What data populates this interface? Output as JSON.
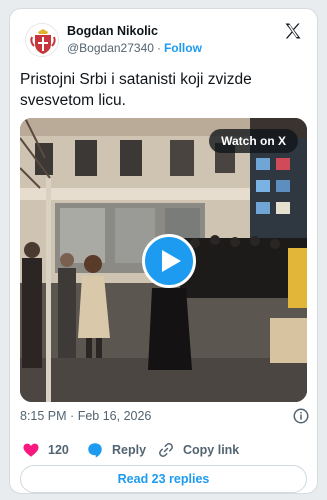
{
  "author": {
    "name": "Bogdan Nikolic",
    "handle": "@Bogdan27340",
    "separator": "·",
    "follow_label": "Follow",
    "avatar_icon": "serbian-coat-of-arms"
  },
  "platform_icon": "x-logo-icon",
  "tweet": {
    "text": "Pristojni Srbi i satanisti koji zvizde svesvetom licu."
  },
  "media": {
    "watch_label": "Watch on X",
    "play_icon": "play-icon"
  },
  "meta": {
    "time": "8:15 PM",
    "separator": "·",
    "date": "Feb 16, 2026",
    "info_icon": "info-icon"
  },
  "actions": {
    "likes": "120",
    "reply_label": "Reply",
    "copy_label": "Copy link"
  },
  "replies_button": "Read 23 replies",
  "colors": {
    "accent": "#1d9bf0",
    "like": "#f91880",
    "text": "#0f1419",
    "secondary": "#536471"
  }
}
